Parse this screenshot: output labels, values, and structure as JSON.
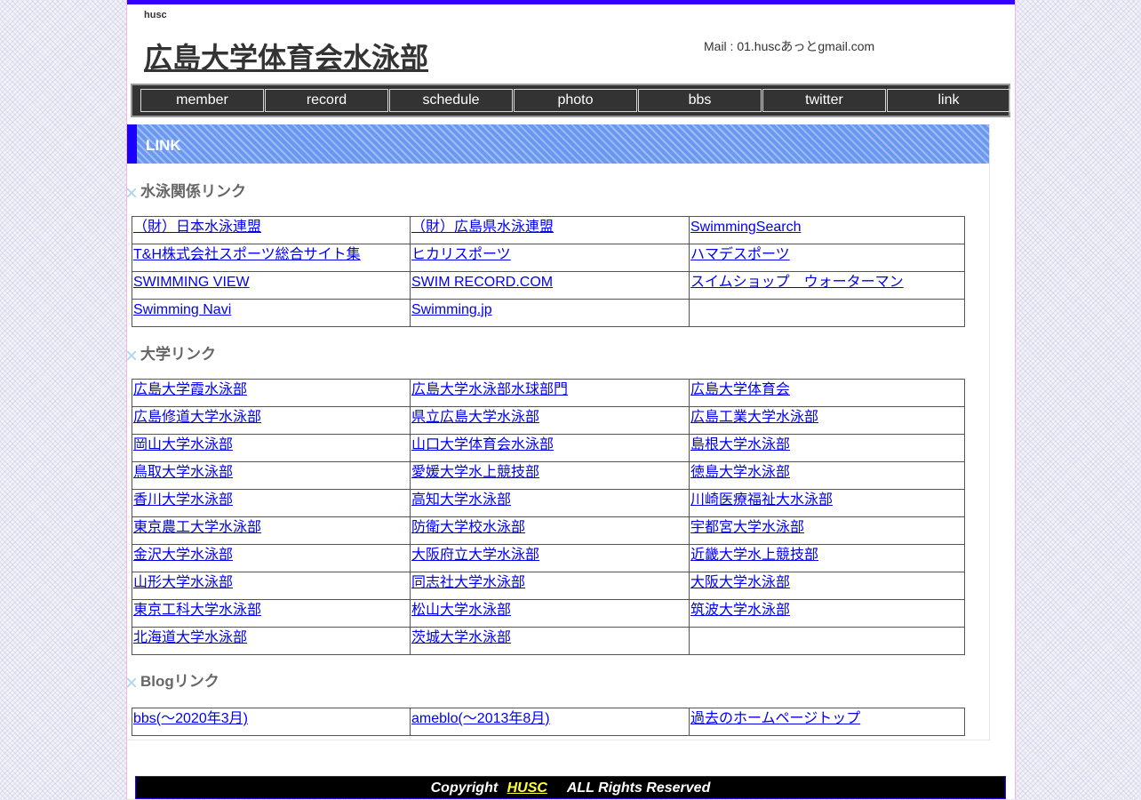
{
  "header": {
    "short_name": "husc",
    "title": "広島大学体育会水泳部",
    "mail": "Mail : 01.huscあっとgmail.com"
  },
  "nav": [
    "member",
    "record",
    "schedule",
    "photo",
    "bbs",
    "twitter",
    "link"
  ],
  "section": {
    "title": "LINK"
  },
  "swimming": {
    "heading": "水泳関係リンク",
    "rows": [
      [
        "（財）日本水泳連盟",
        "（財）広島県水泳連盟",
        "SwimmingSearch"
      ],
      [
        "T&H株式会社スポーツ総合サイト集",
        "ヒカリスポーツ",
        "ハマデスポーツ"
      ],
      [
        "SWIMMING VIEW",
        "SWIM RECORD.COM",
        "スイムショップ　ウォーターマン"
      ],
      [
        "Swimming Navi",
        "Swimming.jp",
        ""
      ]
    ]
  },
  "university": {
    "heading": "大学リンク",
    "rows": [
      [
        "広島大学霞水泳部",
        "広島大学水泳部水球部門",
        "広島大学体育会"
      ],
      [
        "広島修道大学水泳部",
        "県立広島大学水泳部",
        "広島工業大学水泳部"
      ],
      [
        "岡山大学水泳部",
        "山口大学体育会水泳部",
        "島根大学水泳部"
      ],
      [
        "鳥取大学水泳部",
        "愛媛大学水上競技部",
        "徳島大学水泳部"
      ],
      [
        "香川大学水泳部",
        "高知大学水泳部",
        "川崎医療福祉大水泳部"
      ],
      [
        "東京農工大学水泳部",
        "防衛大学校水泳部",
        "宇都宮大学水泳部"
      ],
      [
        "金沢大学水泳部",
        "大阪府立大学水泳部",
        "近畿大学水上競技部"
      ],
      [
        "山形大学水泳部",
        "同志社大学水泳部",
        "大阪大学水泳部"
      ],
      [
        "東京工科大学水泳部",
        "松山大学水泳部",
        "筑波大学水泳部"
      ],
      [
        "北海道大学水泳部",
        "茨城大学水泳部",
        ""
      ]
    ]
  },
  "blog": {
    "heading": "Blogリンク",
    "rows": [
      [
        "bbs(～2020年3月)",
        "ameblo(～2013年8月)",
        "過去のホームページトップ"
      ]
    ]
  },
  "footer": {
    "copyright": "Copyright",
    "owner": "HUSC",
    "rights": "ALL Rights Reserved"
  },
  "colors": {
    "top_bar": "#3300ff",
    "section_accent": "#1c00ff",
    "section_band": "#6a98f0",
    "link": "#0000ee",
    "footer_link": "#ffff33"
  }
}
